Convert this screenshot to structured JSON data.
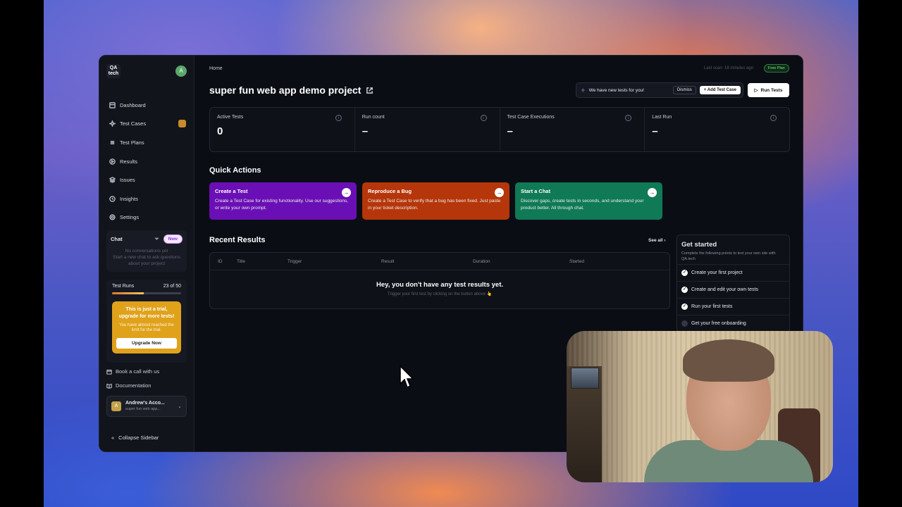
{
  "app": {
    "logo_text": "QA tech",
    "user_initial": "A"
  },
  "sidebar": {
    "items": [
      {
        "label": "Dashboard",
        "icon": "dashboard-icon"
      },
      {
        "label": "Test Cases",
        "icon": "sparkle-icon",
        "badge": true
      },
      {
        "label": "Test Plans",
        "icon": "list-icon"
      },
      {
        "label": "Results",
        "icon": "play-circle-icon"
      },
      {
        "label": "Issues",
        "icon": "layers-icon"
      },
      {
        "label": "Insights",
        "icon": "clock-icon"
      },
      {
        "label": "Settings",
        "icon": "gear-icon"
      }
    ],
    "chat": {
      "label": "Chat",
      "new_label": "New",
      "empty_title": "No conversations yet",
      "empty_sub": "Start a new chat to ask questions about your project"
    },
    "test_runs": {
      "label": "Test Runs",
      "count_text": "23 of 50",
      "progress": 0.46
    },
    "upgrade": {
      "title": "This is just a trial, upgrade for more tests!",
      "sub": "You have almost reached the limit for the trial.",
      "button": "Upgrade Now"
    },
    "book_call": "Book a call with us",
    "documentation": "Documentation",
    "account": {
      "initial": "A",
      "name": "Andrew's Acco...",
      "project": "super fun web app..."
    },
    "collapse": "Collapse Sidebar"
  },
  "header": {
    "breadcrumb": "Home",
    "last_scan": "Last scan: 18 minutes ago",
    "plan": "Free Plan",
    "title": "super fun web app demo project",
    "notice": "We have new tests for you!",
    "dismiss": "Dismiss",
    "add_test_case": "Add Test Case",
    "run_tests": "Run Tests"
  },
  "stats": [
    {
      "label": "Active Tests",
      "value": "0"
    },
    {
      "label": "Run count",
      "value": "–"
    },
    {
      "label": "Test Case Executions",
      "value": "–"
    },
    {
      "label": "Last Run",
      "value": "–"
    }
  ],
  "quick_actions": {
    "title": "Quick Actions",
    "cards": [
      {
        "title": "Create a Test",
        "desc": "Create a Test Case for existing functionality. Use our suggestions, or write your own prompt.",
        "color": "#6a0fb5"
      },
      {
        "title": "Reproduce a Bug",
        "desc": "Create a Test Case to verify that a bug has been fixed. Just paste in your ticket description.",
        "color": "#b5360a"
      },
      {
        "title": "Start a Chat",
        "desc": "Discover gaps, create tests in seconds, and understand your product better. All through chat.",
        "color": "#0f7a55"
      }
    ]
  },
  "recent_results": {
    "title": "Recent Results",
    "see_all": "See all",
    "columns": [
      "ID",
      "Title",
      "Trigger",
      "Result",
      "Duration",
      "Started"
    ],
    "empty_title": "Hey, you don't have any test results yet.",
    "empty_sub": "Trigger your first test by clicking on the button above 👆"
  },
  "get_started": {
    "title": "Get started",
    "sub": "Complete the following points to test your own site with QA.tech",
    "items": [
      {
        "label": "Create your first project",
        "done": true
      },
      {
        "label": "Create and edit your own tests",
        "done": true
      },
      {
        "label": "Run your first tests",
        "done": true
      },
      {
        "label": "Get your free onboarding",
        "done": false
      }
    ]
  }
}
